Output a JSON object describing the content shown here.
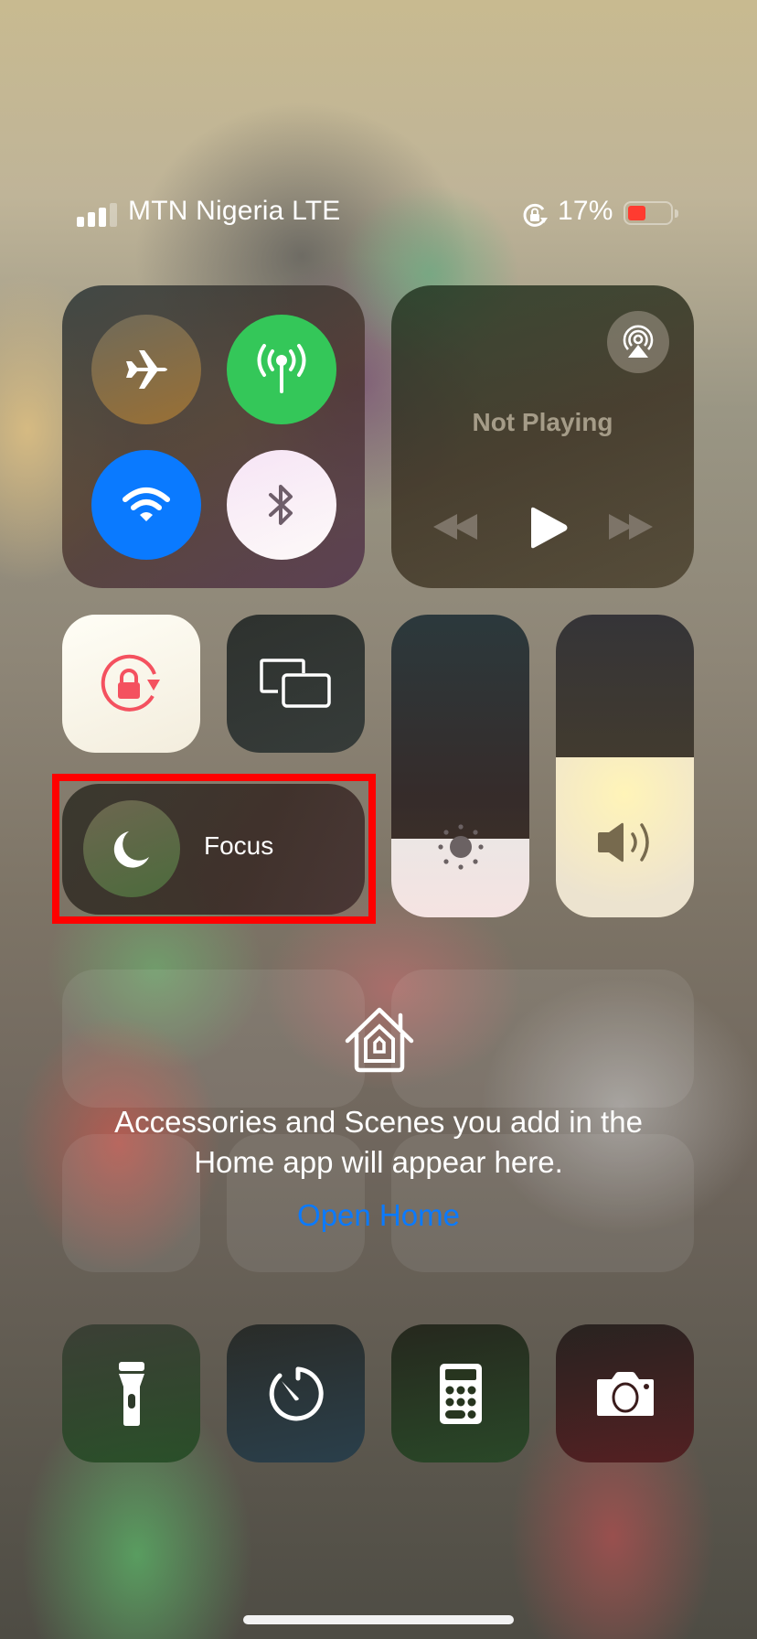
{
  "status_bar": {
    "signal_bars_filled": 3,
    "signal_bars_total": 4,
    "carrier": "MTN Nigeria LTE",
    "orientation_lock_icon": "orientation-lock-icon",
    "battery_percent_label": "17%",
    "battery_level": 0.17,
    "battery_color": "#ff3b30"
  },
  "connectivity": {
    "airplane_mode": {
      "icon": "airplane-icon",
      "on": false
    },
    "cellular_data": {
      "icon": "cellular-antenna-icon",
      "on": true,
      "color": "#34c759"
    },
    "wifi": {
      "icon": "wifi-icon",
      "on": true,
      "color": "#0a7aff"
    },
    "bluetooth": {
      "icon": "bluetooth-icon",
      "on": false
    }
  },
  "media": {
    "status": "Not Playing",
    "airplay_icon": "airplay-audio-icon",
    "controls": [
      "rewind-icon",
      "play-icon",
      "fast-forward-icon"
    ]
  },
  "orientation_lock_tile": {
    "icon": "orientation-lock-icon",
    "on": true,
    "icon_color": "#f4515f"
  },
  "screen_mirroring_tile": {
    "icon": "screen-mirroring-icon"
  },
  "focus": {
    "label": "Focus",
    "icon": "moon-icon"
  },
  "brightness": {
    "icon": "sun-icon",
    "level": 0.26
  },
  "volume": {
    "icon": "speaker-volume-icon",
    "level": 0.53
  },
  "home": {
    "icon": "home-icon",
    "message_line1": "Accessories and Scenes you add in the",
    "message_line2": "Home app will appear here.",
    "open_home_label": "Open Home",
    "link_color": "#0a7aff"
  },
  "bottom_row": [
    {
      "name": "flashlight",
      "icon": "flashlight-icon"
    },
    {
      "name": "timer",
      "icon": "timer-icon"
    },
    {
      "name": "calculator",
      "icon": "calculator-icon"
    },
    {
      "name": "camera",
      "icon": "camera-icon"
    }
  ],
  "highlight": {
    "target": "focus",
    "color": "#ff0000"
  }
}
